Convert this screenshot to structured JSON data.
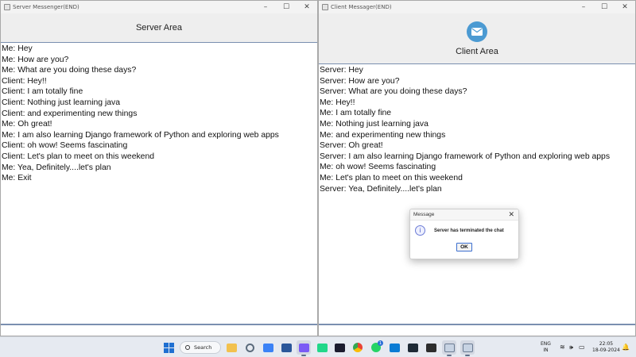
{
  "server": {
    "window_title": "Server Messenger(END)",
    "heading": "Server Area",
    "messages": [
      "Me: Hey",
      "Me: How are you?",
      "Me: What are you doing these days?",
      "Client: Hey!!",
      "Client: I am totally fine",
      "Client: Nothing just learning java",
      "Client: and experimenting new things",
      "Me: Oh great!",
      "Me: I am also learning Django framework of Python and exploring web apps",
      "Client: oh wow! Seems fascinating",
      "Client: Let's plan to meet on this weekend",
      "Me: Yea, Definitely....let's plan",
      "Me: Exit"
    ],
    "input_value": ""
  },
  "client": {
    "window_title": "Client Messager(END)",
    "heading": "Client Area",
    "header_icon": "mail-icon",
    "messages": [
      "Server: Hey",
      "Server: How are you?",
      "Server: What are you doing these days?",
      "Me: Hey!!",
      "Me: I am totally fine",
      "Me: Nothing just learning java",
      "Me: and experimenting new things",
      "Server: Oh great!",
      "Server: I am also learning Django framework of Python and exploring web apps",
      "Me: oh wow! Seems fascinating",
      "Me: Let's plan to meet on this weekend",
      "Server: Yea, Definitely....let's plan"
    ],
    "input_value": ""
  },
  "window_controls": {
    "minimize": "–",
    "maximize": "☐",
    "close": "✕"
  },
  "dialog": {
    "title": "Message",
    "close": "✕",
    "icon": "info-icon",
    "icon_glyph": "i",
    "message": "Server has terminated the chat",
    "ok_label": "OK"
  },
  "taskbar": {
    "search_label": "Search",
    "apps": [
      "windows-start-icon",
      "file-explorer-icon",
      "settings-icon",
      "store-icon",
      "word-icon",
      "paint-icon",
      "pycharm-icon",
      "intellij-icon",
      "chrome-icon",
      "whatsapp-icon",
      "vscode-icon",
      "media-icon",
      "terminal-icon",
      "java-app-icon",
      "java-app-icon"
    ],
    "whatsapp_badge": "1",
    "language": "ENG",
    "region": "IN",
    "time": "22:05",
    "date": "18-09-2024"
  },
  "colors": {
    "accent_blue": "#4b9ad2",
    "border_blue": "#7a8fb0",
    "window_bg": "#ffffff",
    "header_bg": "#eeeeee",
    "taskbar_bg": "#e6eaf1"
  }
}
